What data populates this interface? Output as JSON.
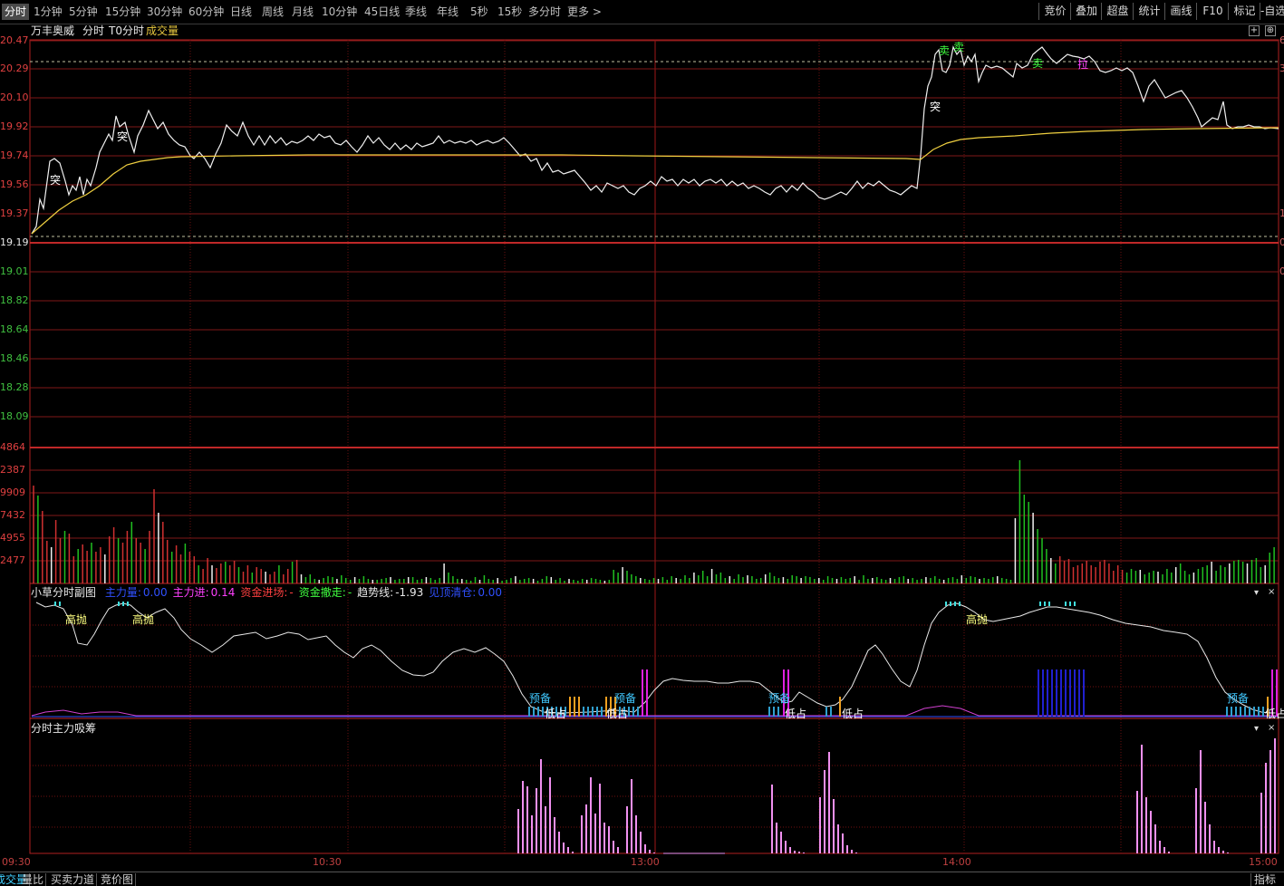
{
  "toolbar": {
    "tabs": [
      "分时",
      "1分钟",
      "5分钟",
      "15分钟",
      "30分钟",
      "60分钟",
      "日线",
      "周线",
      "月线",
      "10分钟",
      "45日线",
      "季线",
      "年线",
      "5秒",
      "15秒",
      "多分时",
      "更多 >"
    ],
    "right_buttons": [
      "竞价",
      "叠加",
      "超盘",
      "统计",
      "画线",
      "F10",
      "标记",
      "-自选"
    ]
  },
  "chart_header": {
    "stock_name": "万丰奥威",
    "mode": "分时",
    "t0": "T0分时",
    "volume_label": "成交量"
  },
  "price_axis": [
    "20.47",
    "20.29",
    "20.10",
    "19.92",
    "19.74",
    "19.56",
    "19.37",
    "19.19",
    "19.01",
    "18.82",
    "18.64",
    "18.46",
    "18.28",
    "18.09"
  ],
  "volume_axis": [
    "4864",
    "2387",
    "9909",
    "7432",
    "4955",
    "2477"
  ],
  "right_axis_marks": [
    "6",
    "3",
    "1",
    "0",
    "0"
  ],
  "time_axis": [
    "09:30",
    "10:30",
    "13:00",
    "14:00",
    "15:00"
  ],
  "price_annotations": [
    {
      "text": "突",
      "color": "#ffffff"
    },
    {
      "text": "突",
      "color": "#ffffff"
    },
    {
      "text": "突",
      "color": "#ffffff"
    },
    {
      "text": "卖",
      "color": "#40ff40"
    },
    {
      "text": "卖",
      "color": "#40ff40"
    },
    {
      "text": "卖",
      "color": "#40ff40"
    },
    {
      "text": "拉",
      "color": "#ff40ff"
    }
  ],
  "indicator1": {
    "title": "小草分时副图",
    "items": [
      {
        "name": "主力量:",
        "value": "0.00",
        "color": "#3050ff"
      },
      {
        "name": "主力进:",
        "value": "0.14",
        "color": "#ff40ff"
      },
      {
        "name": "资金进场:",
        "value": "-",
        "color": "#ff4040"
      },
      {
        "name": "资金撤走:",
        "value": "-",
        "color": "#40ff40"
      },
      {
        "name": "趋势线:",
        "value": "-1.93",
        "color": "#e8e8e8"
      },
      {
        "name": "见顶清仓:",
        "value": "0.00",
        "color": "#3050ff"
      }
    ],
    "tags": [
      {
        "text": "高抛",
        "color": "#ffff80"
      },
      {
        "text": "高抛",
        "color": "#ffff80"
      },
      {
        "text": "高抛",
        "color": "#ffff80"
      },
      {
        "text": "预备",
        "color": "#40c8ff"
      },
      {
        "text": "低占",
        "color": "#ffffff"
      },
      {
        "text": "预备",
        "color": "#40c8ff"
      },
      {
        "text": "低占",
        "color": "#ffffff"
      },
      {
        "text": "预备",
        "color": "#40c8ff"
      },
      {
        "text": "低占",
        "color": "#ffffff"
      },
      {
        "text": "低占",
        "color": "#ffffff"
      },
      {
        "text": "预备",
        "color": "#40c8ff"
      },
      {
        "text": "低占",
        "color": "#ffffff"
      }
    ]
  },
  "indicator2": {
    "title": "分时主力吸筹"
  },
  "panel_controls": {
    "collapse": "▾",
    "close": "×"
  },
  "bottom_tabs": [
    "成交量",
    "量比",
    "买卖力道",
    "竞价图"
  ],
  "bottom_right": "指标"
}
